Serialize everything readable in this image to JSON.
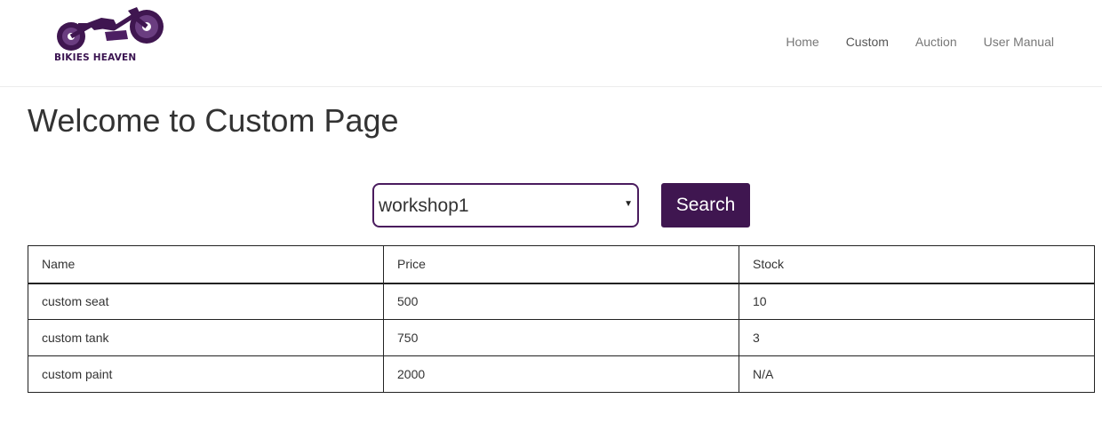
{
  "brand": {
    "name": "BIKIES HEAVEN",
    "color": "#3f1650"
  },
  "nav": {
    "items": [
      {
        "label": "Home",
        "active": false
      },
      {
        "label": "Custom",
        "active": true
      },
      {
        "label": "Auction",
        "active": false
      },
      {
        "label": "User Manual",
        "active": false
      }
    ]
  },
  "page": {
    "title": "Welcome to Custom Page"
  },
  "filter": {
    "selected": "workshop1",
    "arrow_icon": "triangle-down-icon",
    "search_label": "Search"
  },
  "table": {
    "headers": [
      "Name",
      "Price",
      "Stock"
    ],
    "rows": [
      [
        "custom seat",
        "500",
        "10"
      ],
      [
        "custom tank",
        "750",
        "3"
      ],
      [
        "custom paint",
        "2000",
        "N/A"
      ]
    ]
  }
}
